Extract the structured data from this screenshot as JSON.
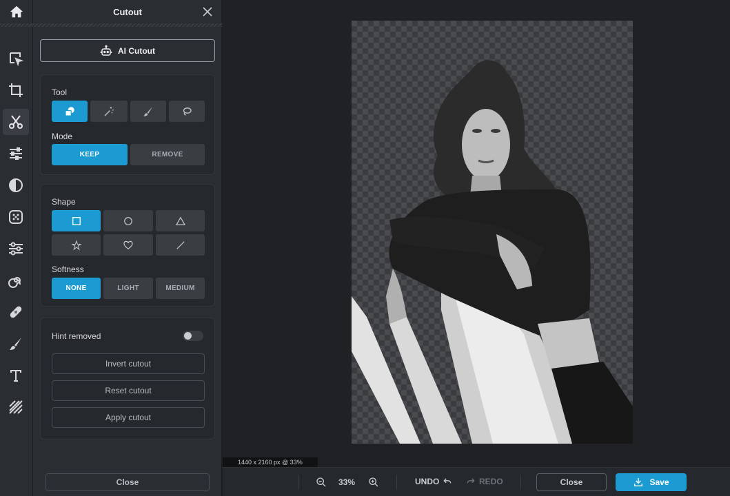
{
  "rail": {
    "items": [
      {
        "name": "home-icon"
      },
      {
        "name": "select-icon"
      },
      {
        "name": "crop-icon"
      },
      {
        "name": "cutout-icon",
        "active": true
      },
      {
        "name": "adjust-icon"
      },
      {
        "name": "filter-icon"
      },
      {
        "name": "effects-icon"
      },
      {
        "name": "retouch-icon"
      },
      {
        "name": "liquify-icon"
      },
      {
        "name": "heal-icon"
      },
      {
        "name": "draw-icon"
      },
      {
        "name": "text-icon"
      },
      {
        "name": "texture-icon"
      }
    ]
  },
  "panel": {
    "title": "Cutout",
    "ai_cutout_label": "AI Cutout",
    "tool_label": "Tool",
    "mode_label": "Mode",
    "mode_keep": "KEEP",
    "mode_remove": "REMOVE",
    "shape_label": "Shape",
    "softness_label": "Softness",
    "softness_none": "NONE",
    "softness_light": "LIGHT",
    "softness_medium": "MEDIUM",
    "hint_removed_label": "Hint removed",
    "hint_removed_on": false,
    "invert_label": "Invert cutout",
    "reset_label": "Reset cutout",
    "apply_label": "Apply cutout",
    "close_label": "Close"
  },
  "canvas": {
    "dimensions": "1440 x 2160 px @ 33%"
  },
  "bottom": {
    "zoom": "33%",
    "undo_label": "UNDO",
    "redo_label": "REDO",
    "close_label": "Close",
    "save_label": "Save"
  },
  "colors": {
    "accent": "#1b9bd1",
    "panel_bg": "#2a2d31",
    "canvas_bg": "#1f2125"
  }
}
